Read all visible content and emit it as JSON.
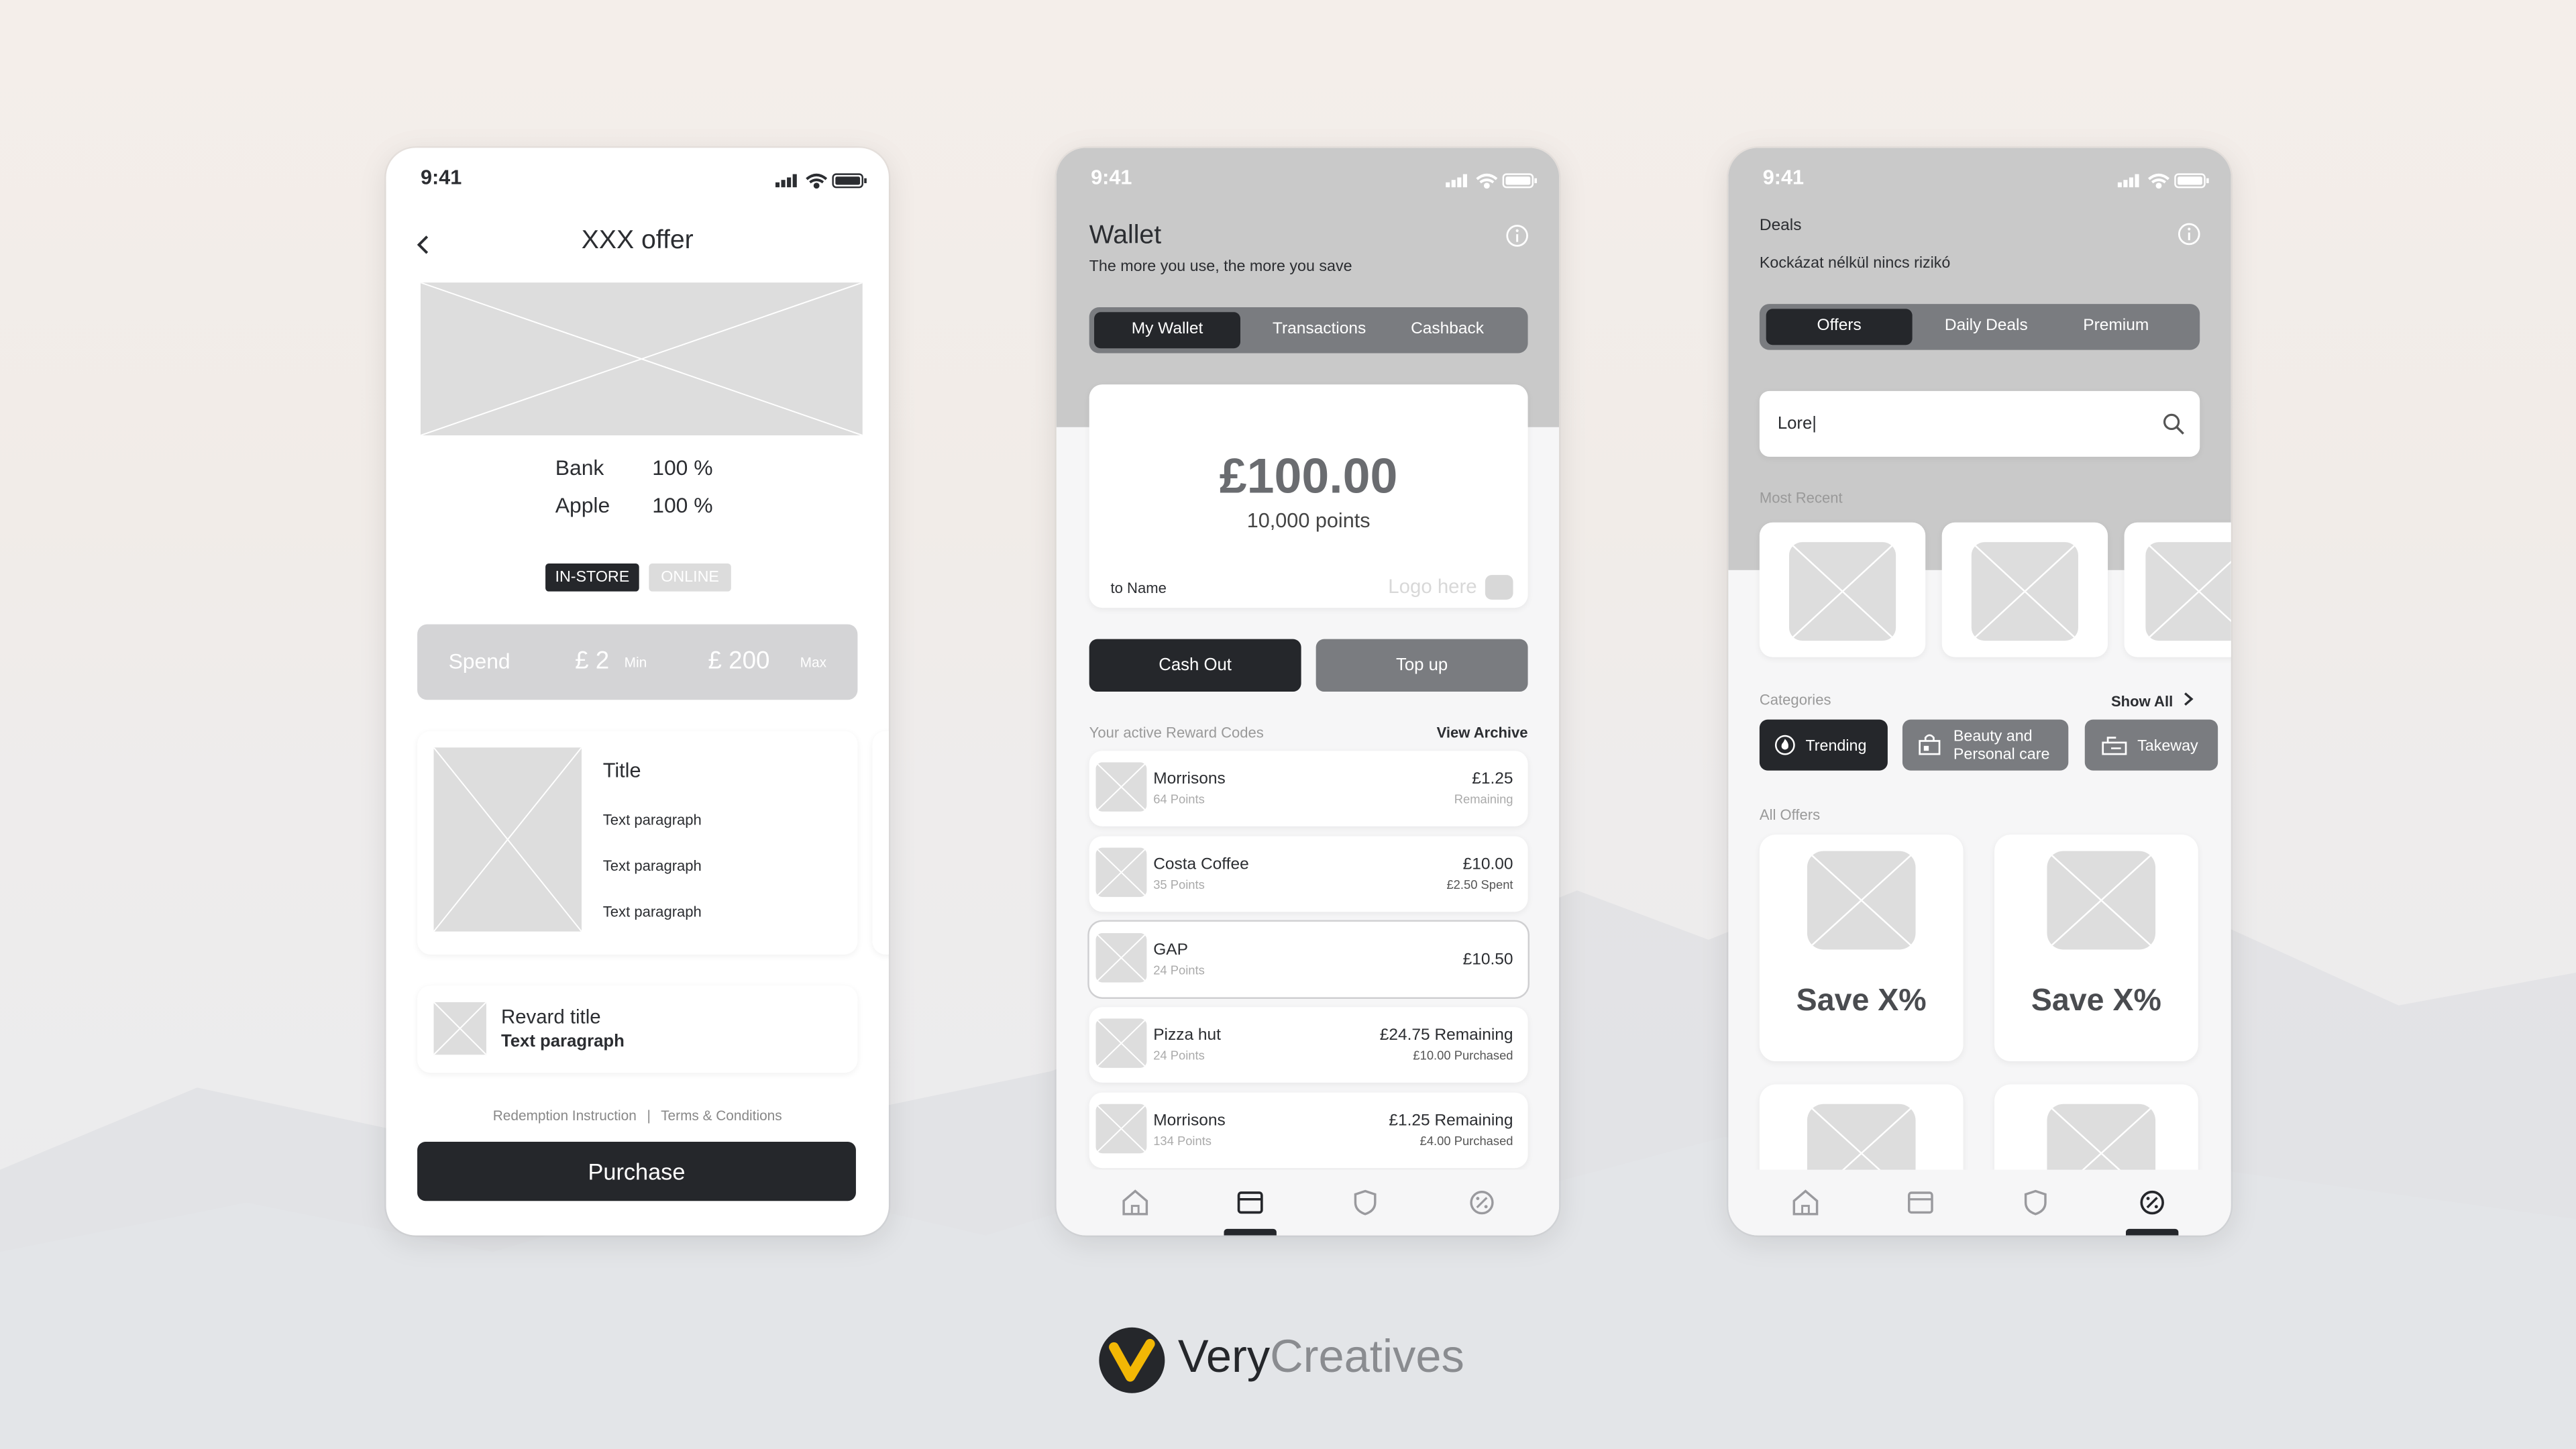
{
  "status": {
    "time": "9:41"
  },
  "offer": {
    "title": "XXX offer",
    "rows": [
      {
        "label": "Bank",
        "value": "100 %"
      },
      {
        "label": "Apple",
        "value": "100 %"
      }
    ],
    "tags": {
      "active": "IN-STORE",
      "inactive": "ONLINE"
    },
    "spend": {
      "label": "Spend",
      "min_value": "£ 2",
      "min_label": "Min",
      "max_value": "£ 200",
      "max_label": "Max"
    },
    "card": {
      "title": "Title",
      "paragraphs": [
        "Text paragraph",
        "Text paragraph",
        "Text paragraph"
      ]
    },
    "reward": {
      "title": "Revard title",
      "text": "Text paragraph"
    },
    "links": {
      "redemption": "Redemption Instruction",
      "separator": "|",
      "terms": "Terms & Conditions"
    },
    "purchase": "Purchase"
  },
  "wallet": {
    "title": "Wallet",
    "subtitle": "The more you use, the more you save",
    "tabs": [
      "My Wallet",
      "Transactions",
      "Cashback"
    ],
    "balance": "£100.00",
    "points": "10,000 points",
    "to_name": "to Name",
    "logo": "Logo here",
    "cash_out": "Cash Out",
    "top_up": "Top up",
    "section_label": "Your active Reward Codes",
    "view_archive": "View Archive",
    "codes": [
      {
        "name": "Morrisons",
        "points": "64 Points",
        "amount": "£1.25",
        "sub": "Remaining"
      },
      {
        "name": "Costa Coffee",
        "points": "35 Points",
        "amount": "£10.00",
        "sub": "£2.50 Spent"
      },
      {
        "name": "GAP",
        "points": "24 Points",
        "amount": "£10.50",
        "sub": ""
      },
      {
        "name": "Pizza hut",
        "points": "24 Points",
        "amount": "£24.75 Remaining",
        "sub": "£10.00 Purchased"
      },
      {
        "name": "Morrisons",
        "points": "134 Points",
        "amount": "£1.25 Remaining",
        "sub": "£4.00 Purchased"
      }
    ]
  },
  "deals": {
    "title": "Deals",
    "subtitle": "Kockázat nélkül nincs rizikó",
    "tabs": [
      "Offers",
      "Daily Deals",
      "Premium"
    ],
    "search_value": "Lore|",
    "most_recent": "Most Recent",
    "categories_label": "Categories",
    "show_all": "Show All",
    "categories": [
      "Trending",
      "Beauty and Personal care",
      "Takeway"
    ],
    "all_offers": "All Offers",
    "offers": [
      "Save X%",
      "Save X%"
    ]
  },
  "brand": {
    "name_dark": "Very",
    "name_light": "Creatives"
  },
  "colors": {
    "dark": "#25272b",
    "mid": "#7a7c80",
    "header_grey": "#c9c9c9",
    "bg": "#f6f6f7",
    "brand_gold": "#f2b705"
  }
}
